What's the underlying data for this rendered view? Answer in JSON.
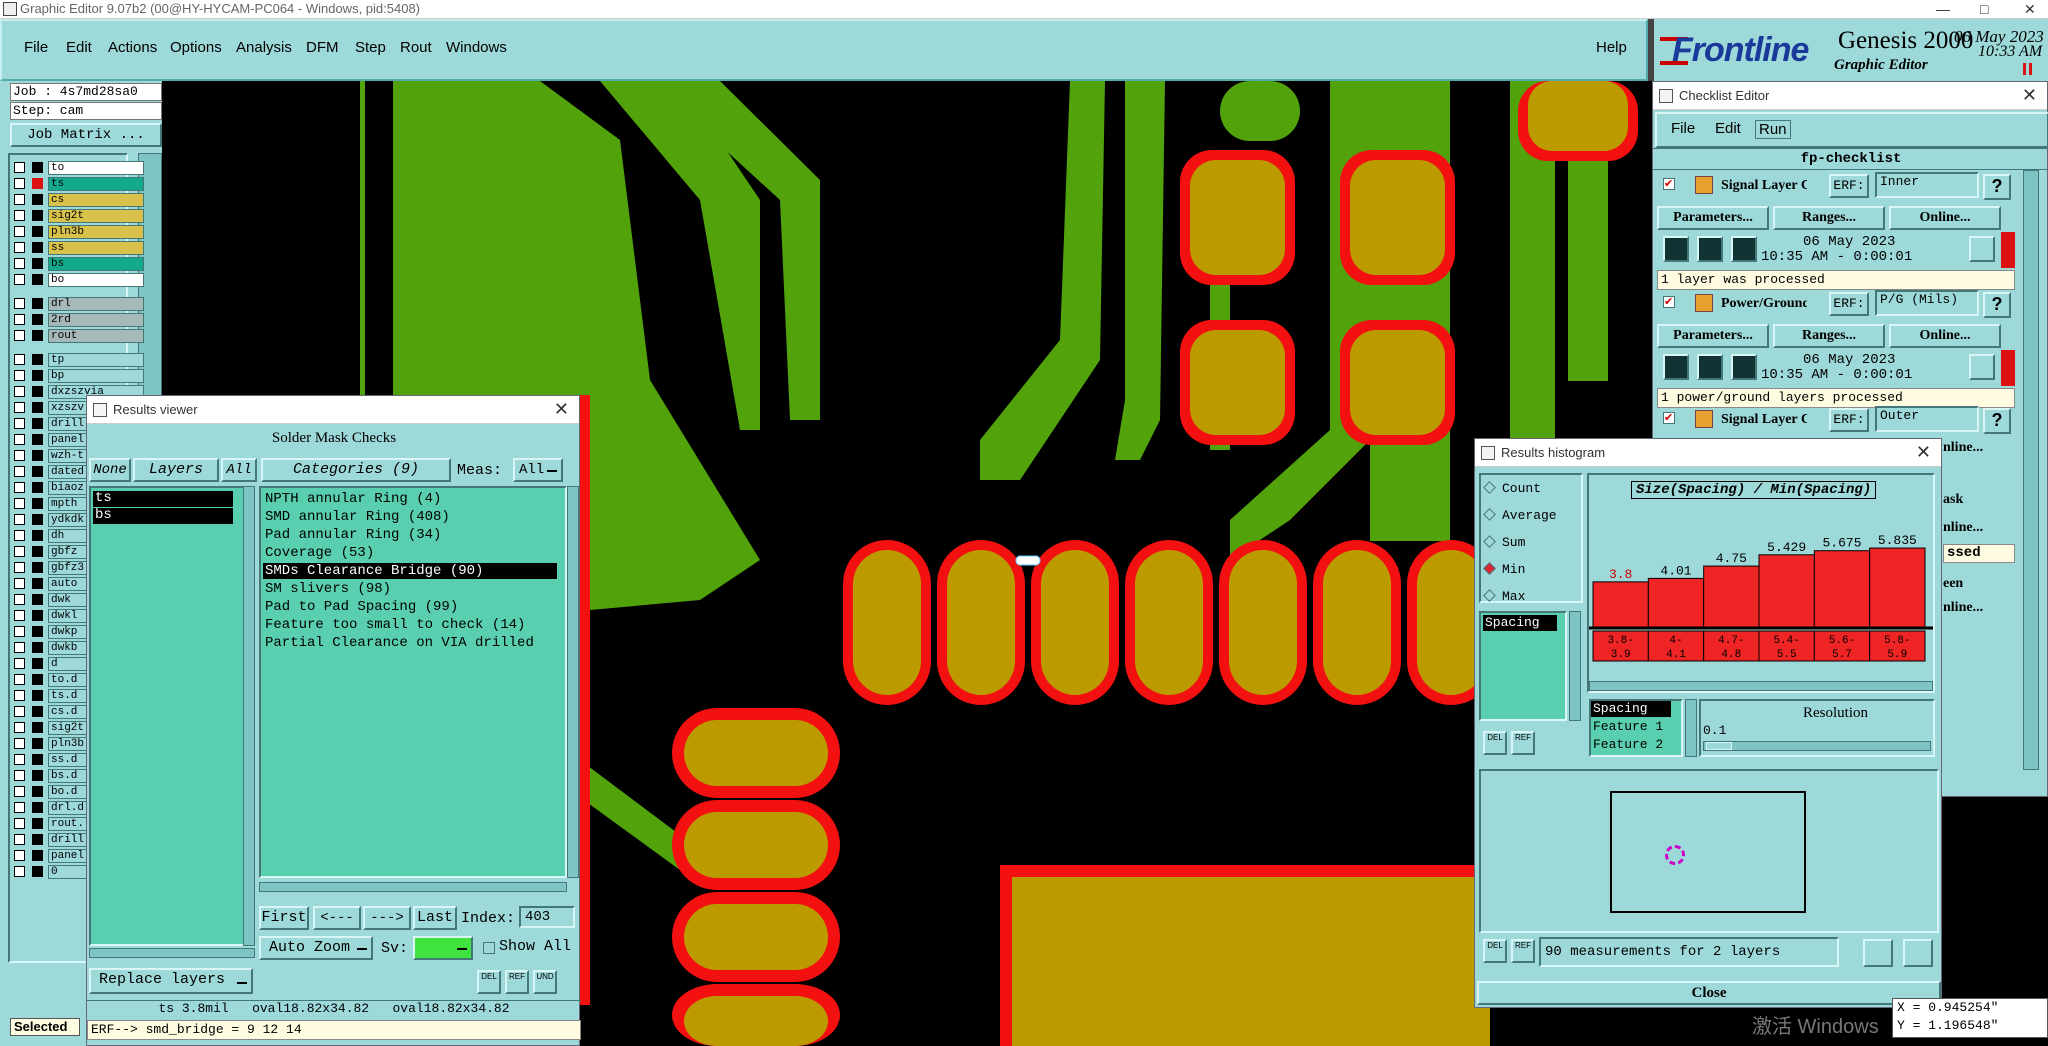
{
  "app": {
    "window_title": "Graphic Editor 9.07b2 (00@HY-HYCAM-PC064 - Windows, pid:5408)",
    "brand": "Frontline",
    "product": "Genesis 2000",
    "subtitle": "Graphic Editor",
    "date": "06 May 2023",
    "time": "10:33 AM"
  },
  "menubar": {
    "items": [
      "File",
      "Edit",
      "Actions",
      "Options",
      "Analysis",
      "DFM",
      "Step",
      "Rout",
      "Windows"
    ],
    "help": "Help"
  },
  "leftpanel": {
    "job": "Job : 4s7md28sa0",
    "step": "Step: cam",
    "job_matrix": "Job Matrix ...",
    "layers": [
      {
        "name": "to",
        "color": "#ffffff"
      },
      {
        "name": "ts",
        "color": "#14a98a"
      },
      {
        "name": "cs",
        "color": "#d9c24a"
      },
      {
        "name": "sig2t",
        "color": "#d9c24a"
      },
      {
        "name": "pln3b",
        "color": "#d9c24a"
      },
      {
        "name": "ss",
        "color": "#d9c24a"
      },
      {
        "name": "bs",
        "color": "#14a98a"
      },
      {
        "name": "bo",
        "color": "#ffffff"
      },
      {
        "name": "drl",
        "color": "#a7b8b8"
      },
      {
        "name": "2rd",
        "color": "#a7b8b8"
      },
      {
        "name": "rout",
        "color": "#a7b8b8"
      },
      {
        "name": "tp",
        "color": "#9ed9da"
      },
      {
        "name": "bp",
        "color": "#9ed9da"
      },
      {
        "name": "dxzszvia",
        "color": "#9ed9da"
      },
      {
        "name": "xzszv",
        "color": "#9ed9da"
      },
      {
        "name": "drill",
        "color": "#9ed9da"
      },
      {
        "name": "panel",
        "color": "#9ed9da"
      },
      {
        "name": "wzh-t",
        "color": "#9ed9da"
      },
      {
        "name": "dated",
        "color": "#9ed9da"
      },
      {
        "name": "biaoz",
        "color": "#9ed9da"
      },
      {
        "name": "mpth",
        "color": "#9ed9da"
      },
      {
        "name": "ydkdk",
        "color": "#9ed9da"
      },
      {
        "name": "dh",
        "color": "#9ed9da"
      },
      {
        "name": "gbfz",
        "color": "#9ed9da"
      },
      {
        "name": "gbfz3",
        "color": "#9ed9da"
      },
      {
        "name": "auto",
        "color": "#9ed9da"
      },
      {
        "name": "dwk",
        "color": "#9ed9da"
      },
      {
        "name": "dwkl",
        "color": "#9ed9da"
      },
      {
        "name": "dwkp",
        "color": "#9ed9da"
      },
      {
        "name": "dwkb",
        "color": "#9ed9da"
      },
      {
        "name": "d",
        "color": "#9ed9da"
      },
      {
        "name": "to.d",
        "color": "#9ed9da"
      },
      {
        "name": "ts.d",
        "color": "#9ed9da"
      },
      {
        "name": "cs.d",
        "color": "#9ed9da"
      },
      {
        "name": "sig2t",
        "color": "#9ed9da"
      },
      {
        "name": "pln3b",
        "color": "#9ed9da"
      },
      {
        "name": "ss.d",
        "color": "#9ed9da"
      },
      {
        "name": "bs.d",
        "color": "#9ed9da"
      },
      {
        "name": "bo.d",
        "color": "#9ed9da"
      },
      {
        "name": "drl.d",
        "color": "#9ed9da"
      },
      {
        "name": "rout.",
        "color": "#9ed9da"
      },
      {
        "name": "drill.",
        "color": "#9ed9da"
      },
      {
        "name": "panel",
        "color": "#9ed9da"
      },
      {
        "name": "0",
        "color": "#9ed9da"
      }
    ],
    "selected_label": "Selected"
  },
  "results_viewer": {
    "title": "Results viewer",
    "header": "Solder Mask Checks",
    "none_btn": "None",
    "layers_btn": "Layers",
    "all_btn": "All",
    "categories_btn": "Categories (9)",
    "meas_label": "Meas:",
    "meas_value": "All",
    "layers": [
      "ts",
      "bs"
    ],
    "categories": [
      "NPTH annular Ring (4)",
      "SMD annular Ring (408)",
      "Pad annular Ring (34)",
      "Coverage (53)",
      "SMDs Clearance Bridge (90)",
      "SM slivers (98)",
      "Pad to Pad Spacing (99)",
      "Feature too small to check (14)",
      "Partial Clearance on VIA drilled"
    ],
    "selected_category_index": 4,
    "first": "First",
    "prev": "<---",
    "next": "--->",
    "last": "Last",
    "index_label": "Index:",
    "index_value": "403",
    "auto_zoom": "Auto Zoom",
    "sv_label": "Sv:",
    "show_all": "Show All",
    "replace_layers": "Replace layers",
    "status": "ts 3.8mil   oval18.82x34.82   oval18.82x34.82",
    "erf": "ERF--> smd_bridge = 9 12 14"
  },
  "checklist": {
    "title": "Checklist Editor",
    "menu": [
      "File",
      "Edit",
      "Run"
    ],
    "name": "fp-checklist",
    "items": [
      {
        "name": "Signal Layer Ch",
        "erf": "ERF:",
        "erf_value": "Inner",
        "date": "06 May 2023",
        "time": "10:35 AM - 0:00:01",
        "status": "1 layer was processed"
      },
      {
        "name": "Power/Ground C",
        "erf": "ERF:",
        "erf_value": "P/G (Mils)",
        "date": "06 May 2023",
        "time": "10:35 AM - 0:00:01",
        "status": "1 power/ground layers processed"
      },
      {
        "name": "Signal Layer Ch",
        "erf": "ERF:",
        "erf_value": "Outer"
      }
    ],
    "params": "Parameters...",
    "ranges": "Ranges...",
    "online": "Online...",
    "partial_labels": [
      "nline...",
      "ask",
      "nline...",
      "ssed",
      "een",
      "nline..."
    ]
  },
  "histogram": {
    "title": "Results histogram",
    "modes": [
      "Count",
      "Average",
      "Sum",
      "Min",
      "Max"
    ],
    "selected_mode": "Min",
    "measure_list": [
      "Spacing"
    ],
    "chart_title": "Size(Spacing) / Min(Spacing)",
    "meas_list2": [
      "Spacing",
      "Feature 1",
      "Feature 2"
    ],
    "resolution_label": "Resolution",
    "resolution_value": "0.1",
    "summary": "90 measurements for 2 layers",
    "close": "Close"
  },
  "chart_data": {
    "type": "bar",
    "title": "Size(Spacing) / Min(Spacing)",
    "categories": [
      "3.8-3.9",
      "4-4.1",
      "4.7-4.8",
      "5.4-5.5",
      "5.6-5.7",
      "5.8-5.9"
    ],
    "values": [
      3.8,
      4.01,
      4.75,
      5.429,
      5.675,
      5.835
    ],
    "value_labels": [
      "3.8",
      "4.01",
      "4.75",
      "5.429",
      "5.675",
      "5.835"
    ],
    "bin_labels_top": [
      "3.8-",
      "4-",
      "4.7-",
      "5.4-",
      "5.6-",
      "5.8-"
    ],
    "bin_labels_bottom": [
      "3.9",
      "4.1",
      "4.8",
      "5.5",
      "5.7",
      "5.9"
    ],
    "ylim": [
      0,
      6.5
    ],
    "colors": {
      "bar": "#ef2424"
    }
  },
  "coords": {
    "x": "X = 0.945254\"",
    "y": "Y = 1.196548\""
  },
  "watermark": "激活 Windows",
  "colors": {
    "copper_green": "#52a20c",
    "pad_gold": "#bc9b00",
    "mask_red": "#f21010",
    "panel": "#9ed9da",
    "list_green": "#59cfb0"
  }
}
